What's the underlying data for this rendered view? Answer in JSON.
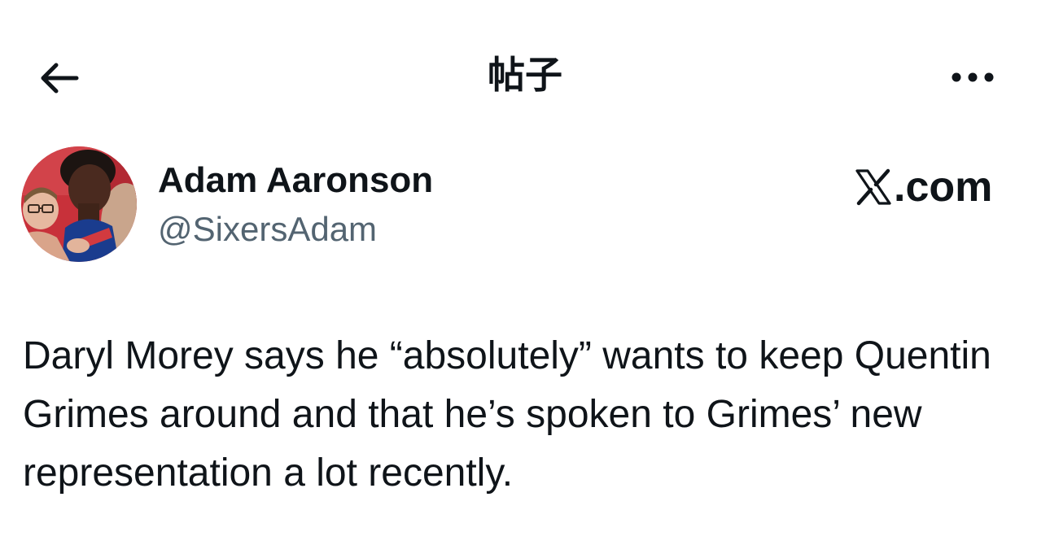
{
  "header": {
    "title": "帖子",
    "back_icon": "arrow-left-icon",
    "more_icon": "more-horizontal-icon"
  },
  "author": {
    "name": "Adam Aaronson",
    "handle": "@SixersAdam",
    "avatar": "avatar-photo"
  },
  "brand": {
    "logo_icon": "x-logo-icon",
    "text": ".com"
  },
  "tweet": {
    "text": "Daryl Morey says he “absolutely” wants to keep Quentin Grimes around and that he’s spoken to Grimes’ new representation a lot recently."
  },
  "colors": {
    "text_primary": "#0f1419",
    "text_secondary": "#536471",
    "background": "#ffffff"
  }
}
